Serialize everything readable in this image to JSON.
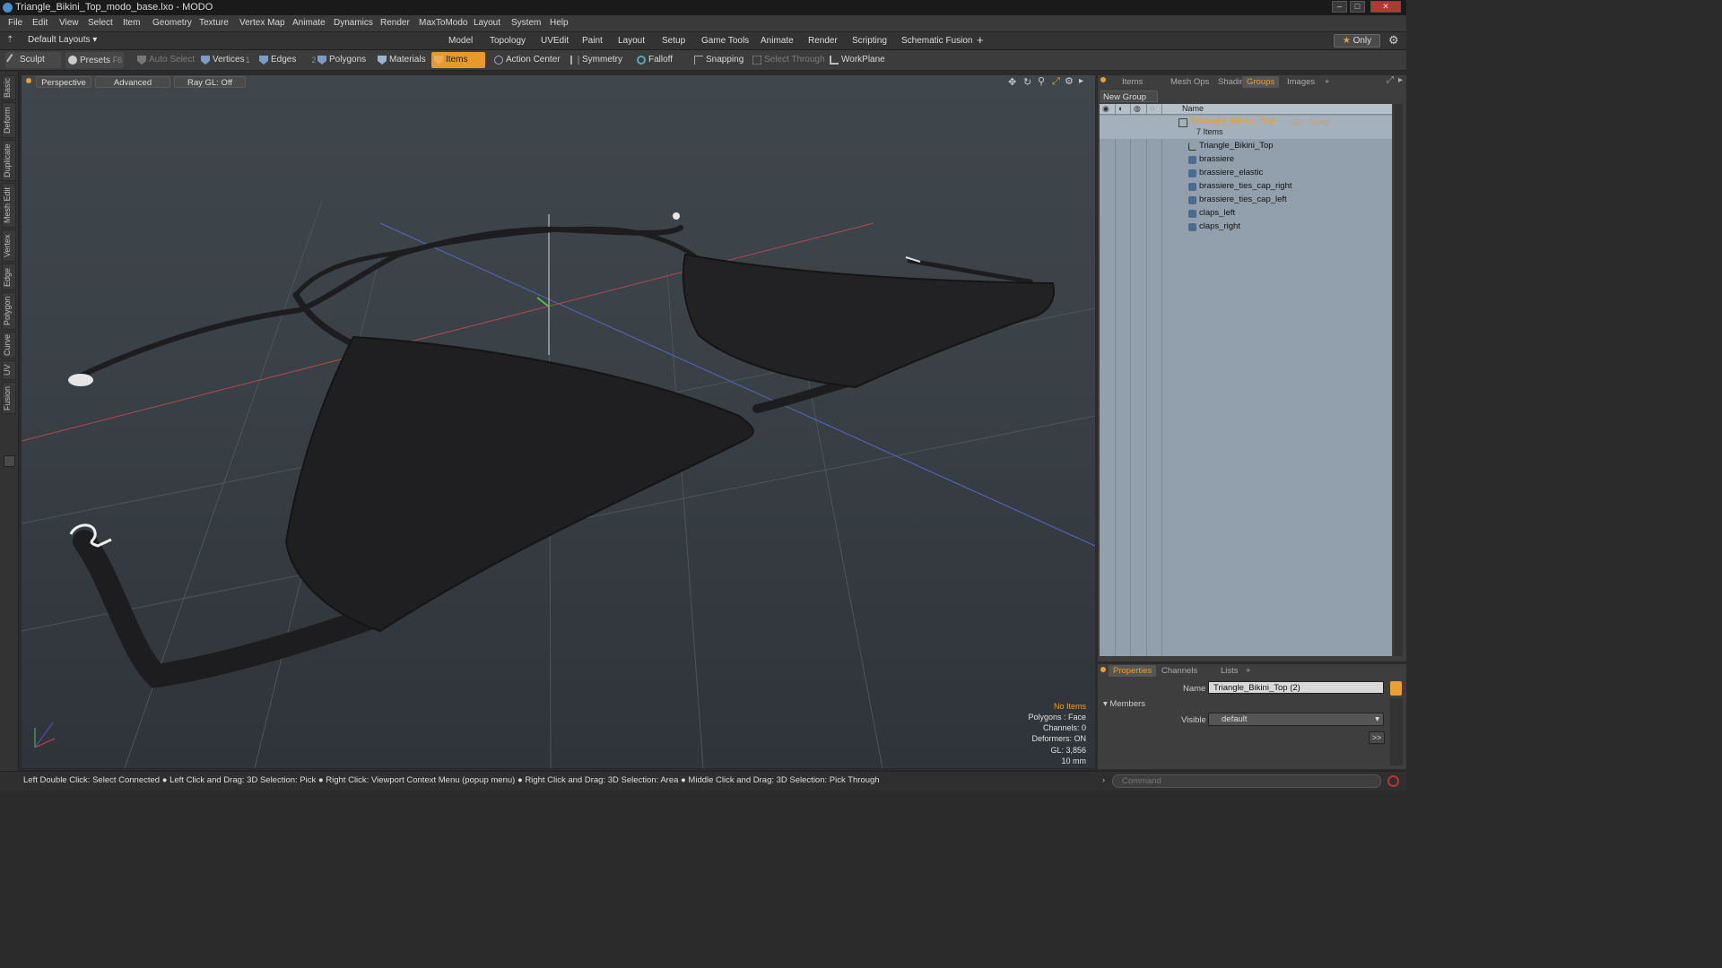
{
  "window": {
    "title": "Triangle_Bikini_Top_modo_base.lxo - MODO"
  },
  "menu": [
    "File",
    "Edit",
    "View",
    "Select",
    "Item",
    "Geometry",
    "Texture",
    "Vertex Map",
    "Animate",
    "Dynamics",
    "Render",
    "MaxToModo",
    "Layout",
    "System",
    "Help"
  ],
  "layoutbar": {
    "layout_selector": "Default Layouts",
    "tabs": [
      "Model",
      "Topology",
      "UVEdit",
      "Paint",
      "Layout",
      "Setup",
      "Game Tools",
      "Animate",
      "Render",
      "Scripting",
      "Schematic Fusion"
    ],
    "active_tab": "Model",
    "add_label": "+",
    "only_label": "Only"
  },
  "toolbar": {
    "sculpt": "Sculpt",
    "presets": "Presets",
    "presets_key": "F6",
    "auto_select": "Auto Select",
    "vertices": "Vertices",
    "vertices_num": "1",
    "edges": "Edges",
    "edges_num": "2",
    "polygons": "Polygons",
    "materials": "Materials",
    "items": "Items",
    "action_center": "Action Center",
    "symmetry": "Symmetry",
    "falloff": "Falloff",
    "snapping": "Snapping",
    "select_through": "Select Through",
    "workplane": "WorkPlane"
  },
  "left_tabs": [
    "Basic",
    "Deform",
    "Duplicate",
    "Mesh Edit",
    "Vertex",
    "Edge",
    "Polygon",
    "Curve",
    "UV",
    "Fusion"
  ],
  "viewport": {
    "view_mode": "Perspective",
    "shading": "Advanced",
    "raygl": "Ray GL: Off",
    "info": {
      "selection": "No Items",
      "polygons": "Polygons : Face",
      "channels": "Channels: 0",
      "deformers": "Deformers: ON",
      "gl": "GL: 3,856",
      "scale": "10 mm"
    }
  },
  "right_panel": {
    "tabs": [
      "Items",
      "Mesh Ops",
      "Shading",
      "Groups",
      "Images"
    ],
    "active_tab": "Groups",
    "add_label": "+",
    "new_group": "New Group",
    "column_name": "Name",
    "group_name": "Triangle_Bikini_Top",
    "group_suffix": "(2) : Group",
    "group_count": "7 Items",
    "items": [
      "Triangle_Bikini_Top",
      "brassiere",
      "brassiere_elastic",
      "brassiere_ties_cap_right",
      "brassiere_ties_cap_left",
      "claps_left",
      "claps_right"
    ]
  },
  "properties": {
    "tabs": [
      "Properties",
      "Channels",
      "Lists"
    ],
    "active_tab": "Properties",
    "add_label": "+",
    "name_label": "Name",
    "name_value": "Triangle_Bikini_Top (2)",
    "members_label": "Members",
    "visible_label": "Visible",
    "visible_value": "default",
    "more_label": ">>"
  },
  "status": {
    "hint": "Left Double Click: Select Connected ● Left Click and Drag: 3D Selection: Pick ● Right Click: Viewport Context Menu (popup menu) ● Right Click and Drag: 3D Selection: Area ● Middle Click and Drag: 3D Selection: Pick Through",
    "command_placeholder": "Command"
  },
  "colors": {
    "accent": "#e8a030",
    "list_bg": "#92a0ad",
    "viewport_bg": "#3a4147"
  }
}
